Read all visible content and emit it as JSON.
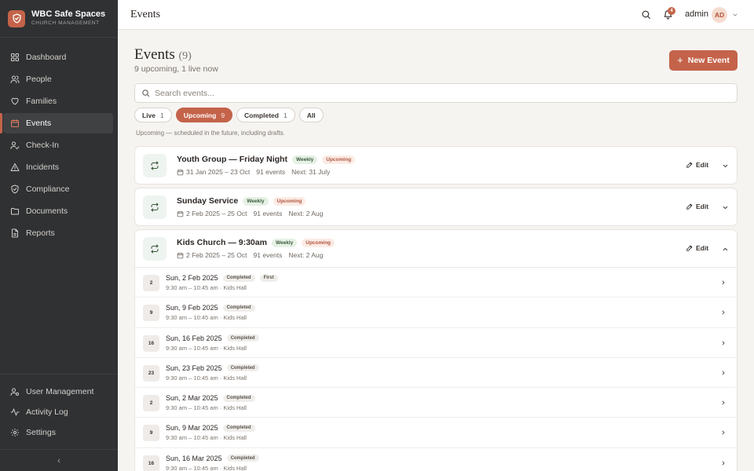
{
  "app": {
    "name": "WBC Safe Spaces",
    "subtitle": "CHURCH MANAGEMENT"
  },
  "sidebar": {
    "items": [
      {
        "label": "Dashboard",
        "icon": "grid-icon"
      },
      {
        "label": "People",
        "icon": "people-icon"
      },
      {
        "label": "Families",
        "icon": "heart-icon"
      },
      {
        "label": "Events",
        "icon": "calendar-icon",
        "active": true
      },
      {
        "label": "Check-In",
        "icon": "user-check-icon"
      },
      {
        "label": "Incidents",
        "icon": "alert-triangle-icon"
      },
      {
        "label": "Compliance",
        "icon": "shield-check-icon"
      },
      {
        "label": "Documents",
        "icon": "folder-icon"
      },
      {
        "label": "Reports",
        "icon": "file-text-icon"
      }
    ],
    "bottom_items": [
      {
        "label": "User Management",
        "icon": "users-cog-icon"
      },
      {
        "label": "Activity Log",
        "icon": "activity-icon"
      },
      {
        "label": "Settings",
        "icon": "gear-icon"
      }
    ],
    "collapse_icon": "chevron-left-icon"
  },
  "header": {
    "title": "Events",
    "notifications_count": "4",
    "user_name": "admin",
    "user_initials": "AD"
  },
  "page": {
    "title": "Events",
    "count": "(9)",
    "subtitle": "9 upcoming, 1 live now",
    "new_button_label": "New Event",
    "search_placeholder": "Search events...",
    "filters": [
      {
        "label": "Live",
        "count": "1"
      },
      {
        "label": "Upcoming",
        "count": "9",
        "active": true
      },
      {
        "label": "Completed",
        "count": "1"
      },
      {
        "label": "All",
        "count": ""
      }
    ],
    "filter_hint": "Upcoming — scheduled in the future, including drafts.",
    "edit_label": "Edit"
  },
  "events": [
    {
      "title": "Youth Group — Friday Night",
      "recurrence": "Weekly",
      "status": "Upcoming",
      "date_range": "31 Jan 2025 – 23 Oct",
      "events_count": "91 events",
      "next": "Next: 31 July",
      "expanded": false
    },
    {
      "title": "Sunday Service",
      "recurrence": "Weekly",
      "status": "Upcoming",
      "date_range": "2 Feb 2025 – 25 Oct",
      "events_count": "91 events",
      "next": "Next: 2 Aug",
      "expanded": false
    },
    {
      "title": "Kids Church — 9:30am",
      "recurrence": "Weekly",
      "status": "Upcoming",
      "date_range": "2 Feb 2025 – 25 Oct",
      "events_count": "91 events",
      "next": "Next: 2 Aug",
      "expanded": true,
      "occurrences": [
        {
          "day": "2",
          "date": "Sun, 2 Feb 2025",
          "status": "Completed",
          "extra": "First",
          "time": "9:30 am – 10:45 am · Kids Hall"
        },
        {
          "day": "9",
          "date": "Sun, 9 Feb 2025",
          "status": "Completed",
          "extra": "",
          "time": "9:30 am – 10:45 am · Kids Hall"
        },
        {
          "day": "16",
          "date": "Sun, 16 Feb 2025",
          "status": "Completed",
          "extra": "",
          "time": "9:30 am – 10:45 am · Kids Hall"
        },
        {
          "day": "23",
          "date": "Sun, 23 Feb 2025",
          "status": "Completed",
          "extra": "",
          "time": "9:30 am – 10:45 am · Kids Hall"
        },
        {
          "day": "2",
          "date": "Sun, 2 Mar 2025",
          "status": "Completed",
          "extra": "",
          "time": "9:30 am – 10:45 am · Kids Hall"
        },
        {
          "day": "9",
          "date": "Sun, 9 Mar 2025",
          "status": "Completed",
          "extra": "",
          "time": "9:30 am – 10:45 am · Kids Hall"
        },
        {
          "day": "16",
          "date": "Sun, 16 Mar 2025",
          "status": "Completed",
          "extra": "",
          "time": "9:30 am – 10:45 am · Kids Hall"
        }
      ]
    }
  ],
  "colors": {
    "accent": "#c4634a",
    "sidebar_bg": "#2f3133",
    "page_bg": "#f6f4f1",
    "weekly_tag": "#e6f1e6",
    "upcoming_tag": "#fcebe5"
  }
}
